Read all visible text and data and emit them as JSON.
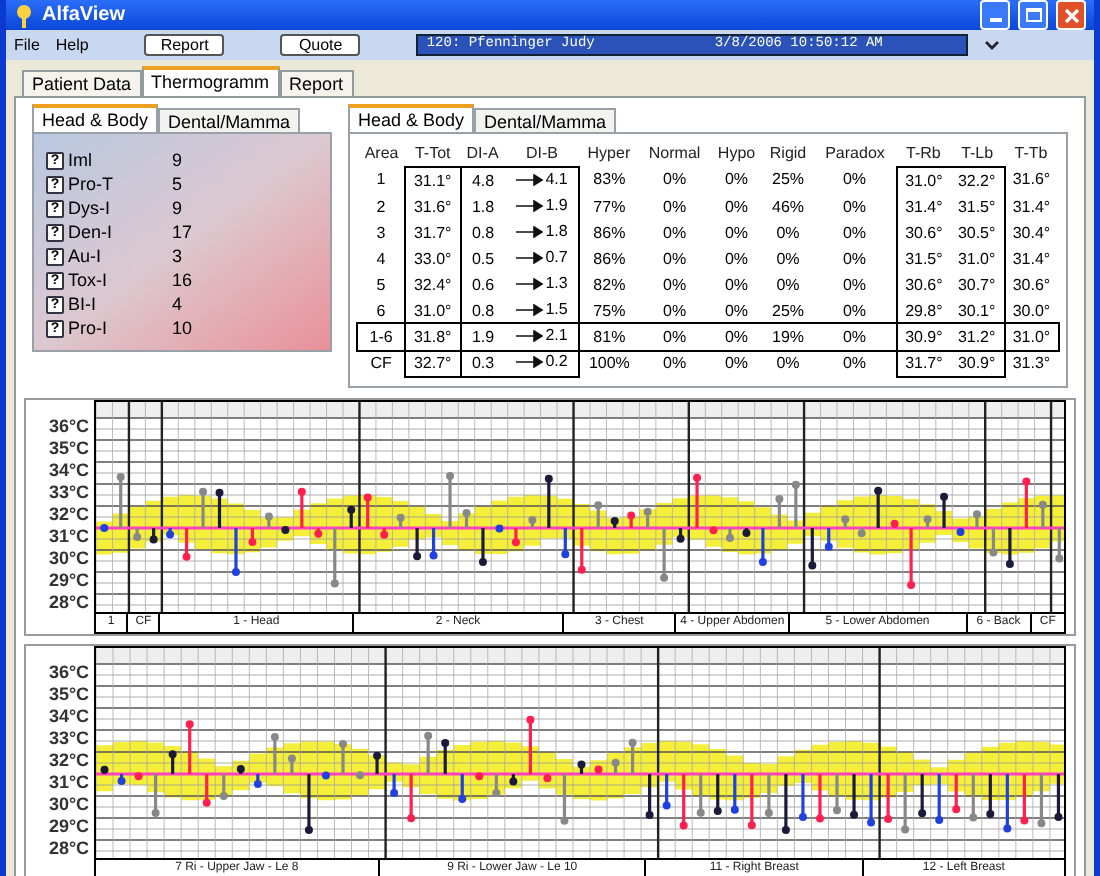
{
  "window": {
    "title": "AlfaView"
  },
  "menu": [
    "File",
    "Help"
  ],
  "toolbar": {
    "buttons": [
      "Report",
      "Quote"
    ],
    "patient": "120: Pfenninger Judy",
    "date": "3/8/2006 10:50:12 AM"
  },
  "tabs": [
    {
      "label": "Patient Data",
      "selected": false
    },
    {
      "label": "Thermogramm",
      "selected": true
    },
    {
      "label": "Report",
      "selected": false
    }
  ],
  "indices_panel": {
    "tabs": [
      {
        "label": "Head & Body",
        "selected": true
      },
      {
        "label": "Dental/Mamma",
        "selected": false
      }
    ],
    "items": [
      {
        "help": "?",
        "label": "Iml",
        "value": "9"
      },
      {
        "help": "?",
        "label": "Pro-T",
        "value": "5"
      },
      {
        "help": "?",
        "label": "Dys-I",
        "value": "9"
      },
      {
        "help": "?",
        "label": "Den-I",
        "value": "17"
      },
      {
        "help": "?",
        "label": "Au-I",
        "value": "3"
      },
      {
        "help": "?",
        "label": "Tox-I",
        "value": "16"
      },
      {
        "help": "?",
        "label": "BI-I",
        "value": "4"
      },
      {
        "help": "?",
        "label": "Pro-I",
        "value": "10"
      }
    ]
  },
  "table_panel": {
    "tabs": [
      {
        "label": "Head & Body",
        "selected": true
      },
      {
        "label": "Dental/Mamma",
        "selected": false
      }
    ],
    "columns": [
      "Area",
      "T-Tot",
      "DI-A",
      "DI-B",
      "Hyper",
      "Normal",
      "Hypo",
      "Rigid",
      "Paradox",
      "T-Rb",
      "T-Lb",
      "T-Tb"
    ],
    "rows": [
      {
        "highlighted": false,
        "cells": [
          "1",
          "31.1°",
          "4.8",
          "4.1",
          "83%",
          "0%",
          "0%",
          "25%",
          "0%",
          "31.0°",
          "32.2°",
          "31.6°"
        ]
      },
      {
        "highlighted": false,
        "cells": [
          "2",
          "31.6°",
          "1.8",
          "1.9",
          "77%",
          "0%",
          "0%",
          "46%",
          "0%",
          "31.4°",
          "31.5°",
          "31.4°"
        ]
      },
      {
        "highlighted": false,
        "cells": [
          "3",
          "31.7°",
          "0.8",
          "1.8",
          "86%",
          "0%",
          "0%",
          "0%",
          "0%",
          "30.6°",
          "30.5°",
          "30.4°"
        ]
      },
      {
        "highlighted": false,
        "cells": [
          "4",
          "33.0°",
          "0.5",
          "0.7",
          "86%",
          "0%",
          "0%",
          "0%",
          "0%",
          "31.5°",
          "31.0°",
          "31.4°"
        ]
      },
      {
        "highlighted": false,
        "cells": [
          "5",
          "32.4°",
          "0.6",
          "1.3",
          "82%",
          "0%",
          "0%",
          "0%",
          "0%",
          "30.6°",
          "30.7°",
          "30.6°"
        ]
      },
      {
        "highlighted": false,
        "cells": [
          "6",
          "31.0°",
          "0.8",
          "1.5",
          "75%",
          "0%",
          "0%",
          "25%",
          "0%",
          "29.8°",
          "30.1°",
          "30.0°"
        ]
      },
      {
        "highlighted": true,
        "cells": [
          "1-6",
          "31.8°",
          "1.9",
          "2.1",
          "81%",
          "0%",
          "0%",
          "19%",
          "0%",
          "30.9°",
          "31.2°",
          "31.0°"
        ]
      },
      {
        "highlighted": false,
        "cells": [
          "CF",
          "32.7°",
          "0.3",
          "0.2",
          "100%",
          "0%",
          "0%",
          "0%",
          "0%",
          "31.7°",
          "30.9°",
          "31.3°"
        ]
      }
    ]
  },
  "charts": [
    {
      "y_labels": [
        "36°C",
        "35°C",
        "34°C",
        "33°C",
        "32°C",
        "31°C",
        "30°C",
        "29°C",
        "28°C"
      ],
      "segments": [
        "1",
        "CF",
        "1 - Head",
        "2 - Neck",
        "3 - Chest",
        "4 - Upper Abdomen",
        "5 - Lower Abdomen",
        "6 - Back",
        "CF"
      ]
    },
    {
      "y_labels": [
        "36°C",
        "35°C",
        "34°C",
        "33°C",
        "32°C",
        "31°C",
        "30°C",
        "29°C",
        "28°C"
      ],
      "segments": [
        "7 Ri - Upper Jaw - Le 8",
        "9 Ri - Lower Jaw - Le 10",
        "11 - Right Breast",
        "12 - Left Breast"
      ]
    }
  ]
}
